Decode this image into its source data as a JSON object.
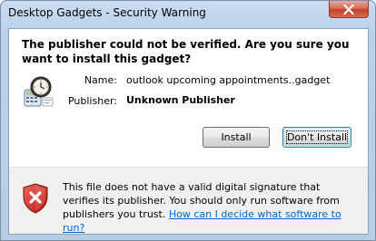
{
  "window": {
    "title": "Desktop Gadgets - Security Warning"
  },
  "dialog": {
    "question": "The publisher could not be verified. Are you sure you want to install this gadget?",
    "name_label": "Name:",
    "name_value": "outlook upcoming appointments..gadget",
    "publisher_label": "Publisher:",
    "publisher_value": "Unknown Publisher",
    "install_button": "Install",
    "dont_install_button": "Don't Install",
    "warning_text": "This file does not have a valid digital signature that verifies its publisher. You should only run software from publishers you trust.",
    "help_link": "How can I decide what software to run?"
  },
  "icons": {
    "gadget": "gadget-clock-calculator-icon",
    "warning": "security-shield-x-icon",
    "close": "close-icon"
  },
  "colors": {
    "link": "#0066cc",
    "close_button": "#c4402a",
    "shield_red": "#d0281e"
  }
}
